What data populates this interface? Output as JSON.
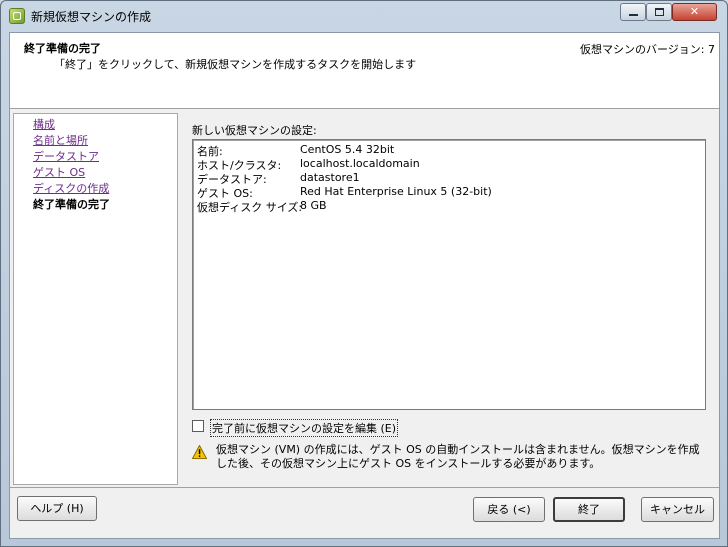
{
  "window": {
    "title": "新規仮想マシンの作成",
    "minimize": "",
    "maximize": "",
    "close": "✕"
  },
  "header": {
    "title": "終了準備の完了",
    "subtitle": "「終了」をクリックして、新規仮想マシンを作成するタスクを開始します",
    "version": "仮想マシンのバージョン: 7"
  },
  "nav": {
    "items": [
      {
        "label": "構成",
        "current": false
      },
      {
        "label": "名前と場所",
        "current": false
      },
      {
        "label": "データストア",
        "current": false
      },
      {
        "label": "ゲスト OS",
        "current": false
      },
      {
        "label": "ディスクの作成",
        "current": false
      },
      {
        "label": "終了準備の完了",
        "current": true
      }
    ]
  },
  "main": {
    "settings_label": "新しい仮想マシンの設定:",
    "summary": [
      {
        "key": "名前:",
        "value": "CentOS 5.4 32bit"
      },
      {
        "key": "ホスト/クラスタ:",
        "value": "localhost.localdomain"
      },
      {
        "key": "データストア:",
        "value": "datastore1"
      },
      {
        "key": "ゲスト OS:",
        "value": "Red Hat Enterprise Linux 5 (32-bit)"
      },
      {
        "key": "仮想ディスク サイズ:",
        "value": "8 GB"
      }
    ],
    "edit_checkbox_label": "完了前に仮想マシンの設定を編集 (E)",
    "edit_checkbox_checked": false,
    "warning": "仮想マシン (VM) の作成には、ゲスト OS の自動インストールは含まれません。仮想マシンを作成した後、その仮想マシン上にゲスト OS をインストールする必要があります。"
  },
  "footer": {
    "help": "ヘルプ (H)",
    "back": "戻る (<)",
    "finish": "終了",
    "cancel": "キャンセル"
  },
  "colors": {
    "link_visited": "#6e2c8c",
    "warning_yellow": "#f5c400"
  }
}
